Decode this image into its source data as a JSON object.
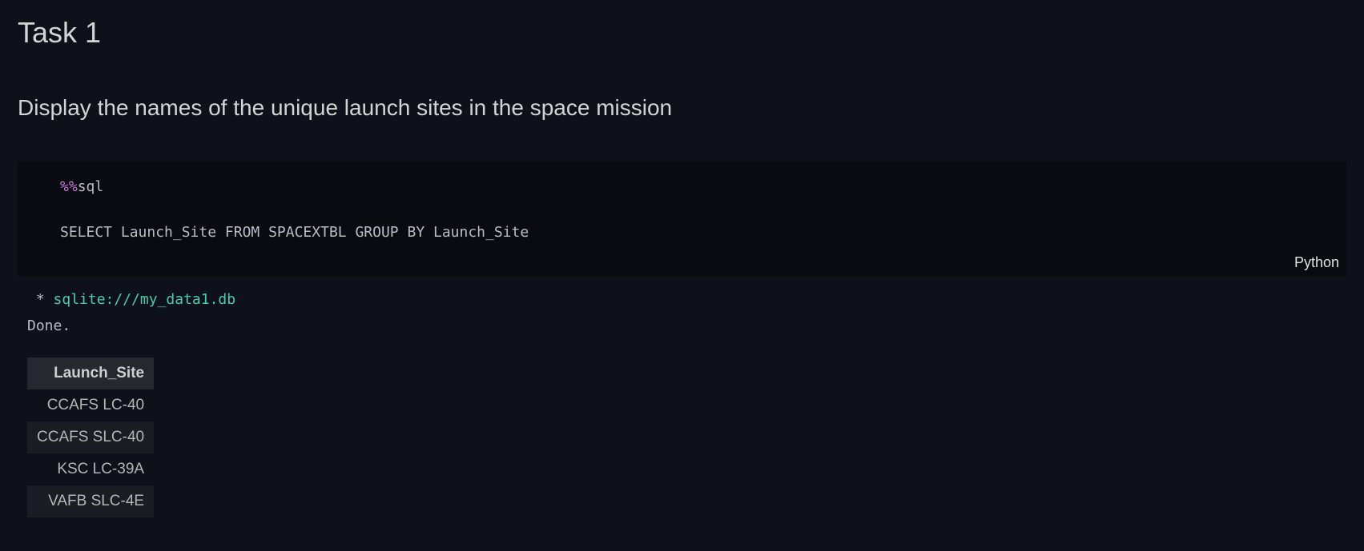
{
  "markdown": {
    "title": "Task 1",
    "description": "Display the names of the unique launch sites in the space mission"
  },
  "code_cell": {
    "magic": "%%",
    "magic_name": "sql",
    "query": "SELECT Launch_Site FROM SPACEXTBL GROUP BY Launch_Site",
    "language": "Python"
  },
  "output": {
    "prefix": " * ",
    "connection": "sqlite:///my_data1.db",
    "status": "Done."
  },
  "table": {
    "header": "Launch_Site",
    "rows": [
      "CCAFS LC-40",
      "CCAFS SLC-40",
      "KSC LC-39A",
      "VAFB SLC-4E"
    ]
  }
}
